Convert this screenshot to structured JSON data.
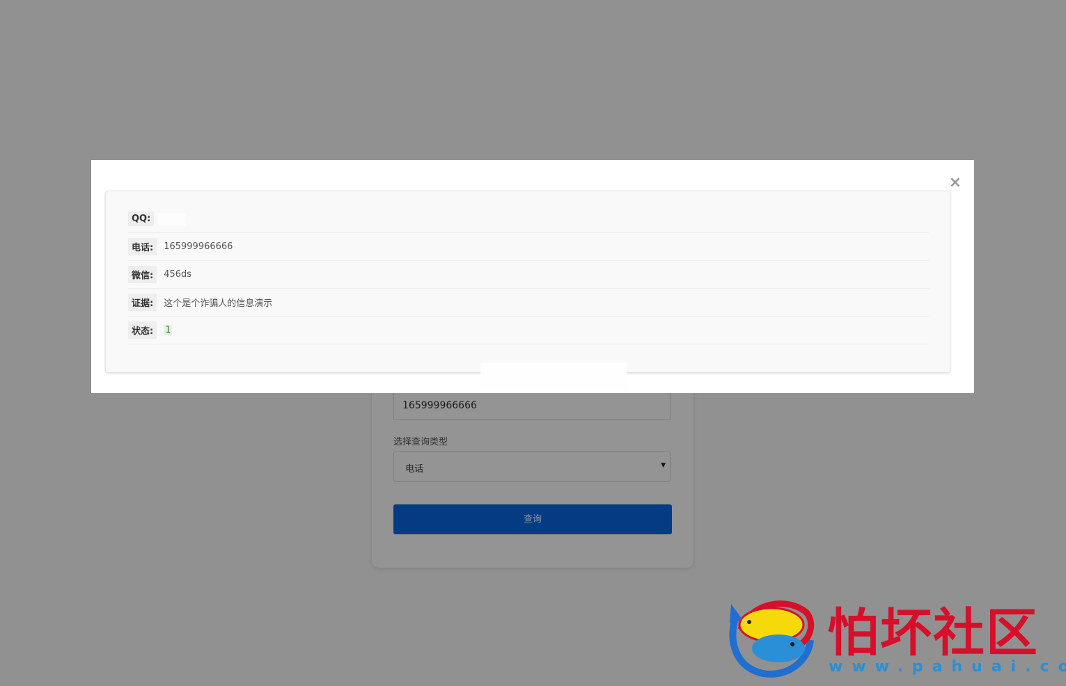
{
  "form": {
    "search_value": "165999966666",
    "type_label": "选择查询类型",
    "type_selected": "电话",
    "submit_label": "查询"
  },
  "modal": {
    "close_glyph": "×",
    "rows": [
      {
        "key": "QQ:",
        "value": ""
      },
      {
        "key": "电话:",
        "value": "165999966666"
      },
      {
        "key": "微信:",
        "value": "456ds"
      },
      {
        "key": "证据:",
        "value": "这个是个诈骗人的信息演示"
      },
      {
        "key": "状态:",
        "value": "1"
      }
    ]
  },
  "watermark": {
    "brand": "怕坏社区",
    "url": "www.pahuai.com"
  }
}
